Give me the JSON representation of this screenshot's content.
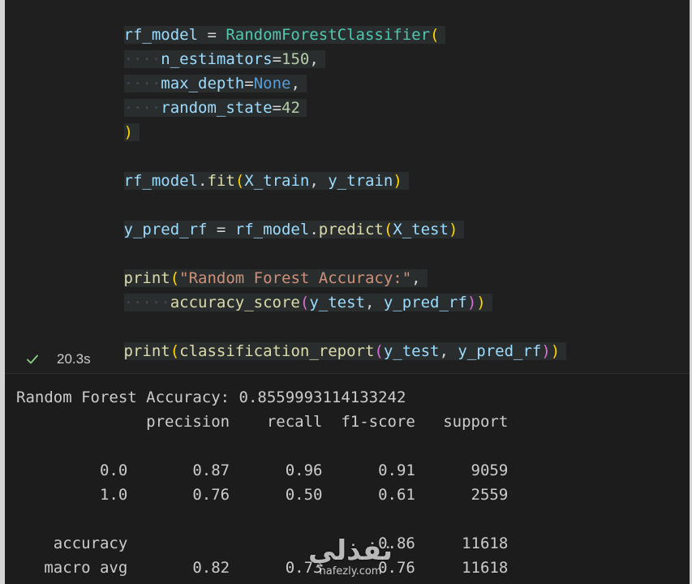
{
  "code_cell": {
    "lines": [
      {
        "parts": [
          "rf_model",
          " = ",
          "RandomForestClassifier",
          "("
        ]
      },
      {
        "indent": "····",
        "parts": [
          "n_estimators",
          "=",
          "150",
          ","
        ]
      },
      {
        "indent": "····",
        "parts": [
          "max_depth",
          "=",
          "None",
          ","
        ]
      },
      {
        "indent": "····",
        "parts": [
          "random_state",
          "=",
          "42"
        ]
      },
      {
        "parts": [
          ")"
        ]
      },
      {
        "parts": [
          "rf_model",
          ".",
          "fit",
          "(",
          "X_train",
          ", ",
          "y_train",
          ")"
        ]
      },
      {
        "parts": [
          "y_pred_rf",
          " = ",
          "rf_model",
          ".",
          "predict",
          "(",
          "X_test",
          ")"
        ]
      },
      {
        "parts": [
          "print",
          "(",
          "\"Random Forest Accuracy:\"",
          ","
        ]
      },
      {
        "indent": "·····",
        "parts": [
          "accuracy_score",
          "(",
          "y_test",
          ", ",
          "y_pred_rf",
          ")",
          ")"
        ]
      },
      {
        "parts": [
          "print",
          "(",
          "classification_report",
          "(",
          "y_test",
          ", ",
          "y_pred_rf",
          ")",
          ")"
        ]
      }
    ]
  },
  "execution": {
    "status_icon": "check-icon",
    "status_color": "#89d185",
    "time": "20.3s"
  },
  "output": {
    "accuracy_line": "Random Forest Accuracy: 0.8559993114133242",
    "header": "              precision    recall  f1-score   support",
    "rows": [
      "         0.0       0.87      0.96      0.91      9059",
      "         1.0       0.76      0.50      0.61      2559",
      "    accuracy                           0.86     11618",
      "   macro avg       0.82      0.73      0.76     11618"
    ]
  },
  "watermark": {
    "logo": "نفذلي",
    "site": "nafezly.com"
  }
}
